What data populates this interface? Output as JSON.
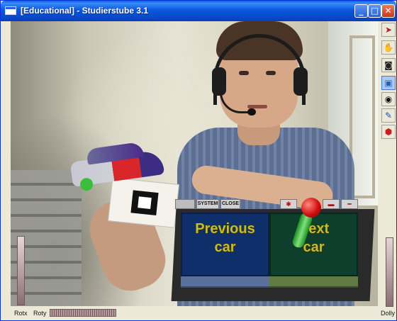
{
  "window": {
    "title": "[Educational] - Studierstube 3.1",
    "controls": {
      "minimize": "_",
      "maximize": "□",
      "close": "✕"
    }
  },
  "panel": {
    "tabs": [
      "SYSTEM",
      "CLOSE"
    ],
    "previous_button": {
      "line1": "Previous",
      "line2": "car"
    },
    "next_button": {
      "line1": "Next",
      "line2": "car"
    }
  },
  "toolbar": {
    "tools": [
      {
        "icon": "pointer-arrow-icon",
        "glyph": "➤"
      },
      {
        "icon": "hand-icon",
        "glyph": "✋"
      },
      {
        "icon": "camera-icon",
        "glyph": "◙"
      },
      {
        "icon": "window-icon",
        "glyph": "▣",
        "active": true
      },
      {
        "icon": "eye-icon",
        "glyph": "◉"
      },
      {
        "icon": "pen-icon",
        "glyph": "✎"
      },
      {
        "icon": "cube-icon",
        "glyph": "⬢"
      }
    ]
  },
  "controls": {
    "rotx_label": "Rotx",
    "roty_label": "Roty",
    "dolly_label": "Dolly"
  }
}
